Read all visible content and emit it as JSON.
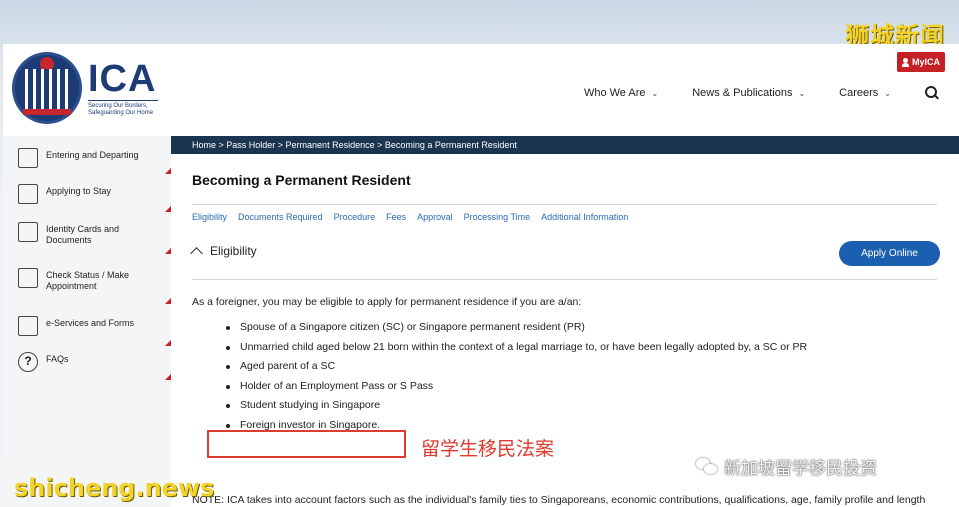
{
  "watermarks": {
    "top_right": "狮城新闻",
    "bottom_left": "shicheng.news",
    "bottom_right": "新加坡留学移民投资"
  },
  "header": {
    "logo_text": "ICA",
    "logo_tagline": "Securing Our Borders, Safeguarding Our Home",
    "myica_label": "MyICA",
    "nav": [
      {
        "label": "Who We Are"
      },
      {
        "label": "News & Publications"
      },
      {
        "label": "Careers"
      }
    ]
  },
  "sidebar": {
    "items": [
      {
        "label": "Entering and Departing",
        "icon": "passport-icon"
      },
      {
        "label": "Applying to Stay",
        "icon": "building-icon"
      },
      {
        "label": "Identity Cards and Documents",
        "icon": "id-card-icon"
      },
      {
        "label": "Check Status / Make Appointment",
        "icon": "calendar-icon"
      },
      {
        "label": "e-Services and Forms",
        "icon": "form-icon"
      },
      {
        "label": "FAQs",
        "icon": "question-icon"
      }
    ]
  },
  "breadcrumb": "Home > Pass Holder > Permanent Residence > Becoming a Permanent Resident",
  "content": {
    "title": "Becoming a Permanent Resident",
    "subtabs": [
      "Eligibility",
      "Documents Required",
      "Procedure",
      "Fees",
      "Approval",
      "Processing Time",
      "Additional Information"
    ],
    "section_title": "Eligibility",
    "apply_button": "Apply Online",
    "intro": "As a foreigner, you may be eligible to apply for permanent residence if you are a/an:",
    "bullets": [
      "Spouse of a Singapore citizen (SC) or Singapore permanent resident (PR)",
      "Unmarried child aged below 21 born within the context of a legal marriage to, or have been legally adopted by, a SC or PR",
      "Aged parent of a SC",
      "Holder of an Employment Pass or S Pass",
      "Student studying in Singapore",
      "Foreign investor in Singapore."
    ],
    "annotation": "留学生移民法案",
    "note": "NOTE: ICA takes into account factors such as the individual's family ties to Singaporeans, economic contributions, qualifications, age, family profile and length of residency, to assess the applicant's ability to contribute to Singapore and integrate into our society, as well as his or her commitment to sinking roots."
  },
  "colors": {
    "brand_navy": "#1d3b74",
    "breadcrumb_bar": "#1b3550",
    "accent_red": "#c42026",
    "link_blue": "#2a6bb5",
    "button_blue": "#1b5fb0",
    "annotation_red": "#e23a2e"
  }
}
